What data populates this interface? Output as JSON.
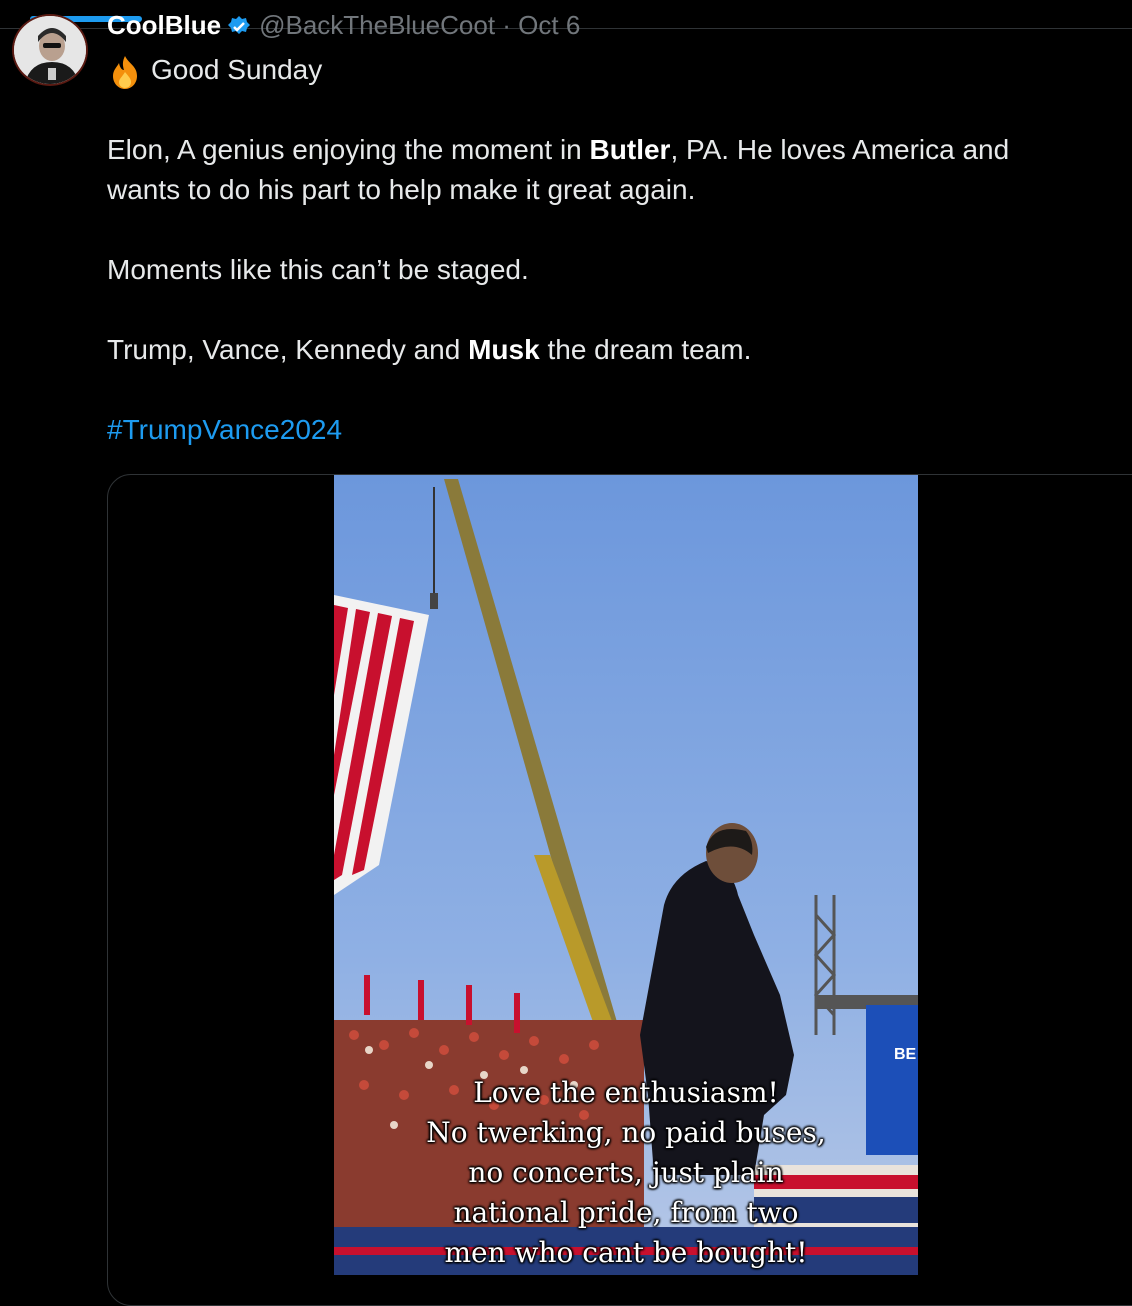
{
  "header": {
    "display_name": "CoolBlue",
    "handle_date": "@BackTheBlueCoot · Oct 6"
  },
  "tweet": {
    "greeting": "Good Sunday",
    "p1_pre": "Elon, A genius enjoying the moment in ",
    "p1_bold": "Butler",
    "p1_post": ", PA. He loves America and",
    "p1_line2": "wants to do his part to help make it great again.",
    "p2": "Moments like this can’t be staged.",
    "p3_pre": "Trump, Vance, Kennedy and ",
    "p3_bold": "Musk",
    "p3_post": " the dream team.",
    "hashtag": "#TrumpVance2024"
  },
  "video": {
    "caption": [
      "Love the enthusiasm!",
      "No twerking, no paid buses,",
      "no concerts, just plain",
      "national pride, from two",
      "men who cant be bought!"
    ],
    "stage_sign_text": "BE"
  },
  "icons": {
    "verified": "verified-badge-icon",
    "fire": "fire-emoji-icon"
  },
  "colors": {
    "accent": "#1d9bf0",
    "background": "#000000",
    "text": "#e7e9ea"
  }
}
